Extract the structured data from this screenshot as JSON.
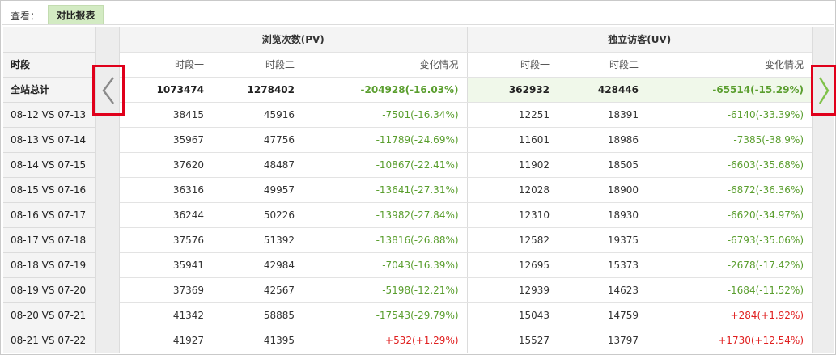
{
  "view": {
    "label": "查看：",
    "tab": "对比报表"
  },
  "groups": {
    "pv": "浏览次数(PV)",
    "uv": "独立访客(UV)"
  },
  "columns": {
    "period": "时段",
    "p1": "时段一",
    "p2": "时段二",
    "change": "变化情况"
  },
  "total": {
    "label": "全站总计",
    "pv1": "1073474",
    "pv2": "1278402",
    "pvc": "-204928(-16.03%)",
    "uv1": "362932",
    "uv2": "428446",
    "uvc": "-65514(-15.29%)"
  },
  "rows": [
    {
      "label": "08-12 VS 07-13",
      "pv1": "38415",
      "pv2": "45916",
      "pvc": "-7501(-16.34%)",
      "uv1": "12251",
      "uv2": "18391",
      "uvc": "-6140(-33.39%)"
    },
    {
      "label": "08-13 VS 07-14",
      "pv1": "35967",
      "pv2": "47756",
      "pvc": "-11789(-24.69%)",
      "uv1": "11601",
      "uv2": "18986",
      "uvc": "-7385(-38.9%)"
    },
    {
      "label": "08-14 VS 07-15",
      "pv1": "37620",
      "pv2": "48487",
      "pvc": "-10867(-22.41%)",
      "uv1": "11902",
      "uv2": "18505",
      "uvc": "-6603(-35.68%)"
    },
    {
      "label": "08-15 VS 07-16",
      "pv1": "36316",
      "pv2": "49957",
      "pvc": "-13641(-27.31%)",
      "uv1": "12028",
      "uv2": "18900",
      "uvc": "-6872(-36.36%)"
    },
    {
      "label": "08-16 VS 07-17",
      "pv1": "36244",
      "pv2": "50226",
      "pvc": "-13982(-27.84%)",
      "uv1": "12310",
      "uv2": "18930",
      "uvc": "-6620(-34.97%)"
    },
    {
      "label": "08-17 VS 07-18",
      "pv1": "37576",
      "pv2": "51392",
      "pvc": "-13816(-26.88%)",
      "uv1": "12582",
      "uv2": "19375",
      "uvc": "-6793(-35.06%)"
    },
    {
      "label": "08-18 VS 07-19",
      "pv1": "35941",
      "pv2": "42984",
      "pvc": "-7043(-16.39%)",
      "uv1": "12695",
      "uv2": "15373",
      "uvc": "-2678(-17.42%)"
    },
    {
      "label": "08-19 VS 07-20",
      "pv1": "37369",
      "pv2": "42567",
      "pvc": "-5198(-12.21%)",
      "uv1": "12939",
      "uv2": "14623",
      "uvc": "-1684(-11.52%)"
    },
    {
      "label": "08-20 VS 07-21",
      "pv1": "41342",
      "pv2": "58885",
      "pvc": "-17543(-29.79%)",
      "uv1": "15043",
      "uv2": "14759",
      "uvc": "+284(+1.92%)"
    },
    {
      "label": "08-21 VS 07-22",
      "pv1": "41927",
      "pv2": "41395",
      "pvc": "+532(+1.29%)",
      "uv1": "15527",
      "uv2": "13797",
      "uvc": "+1730(+12.54%)"
    }
  ],
  "colors": {
    "negative": "#5a9e2e",
    "positive": "#e02020",
    "highlight": "#e0001b",
    "tab_bg": "#d3ebc3"
  },
  "icons": {
    "prev": "chevron-left-icon",
    "next": "chevron-right-icon"
  }
}
